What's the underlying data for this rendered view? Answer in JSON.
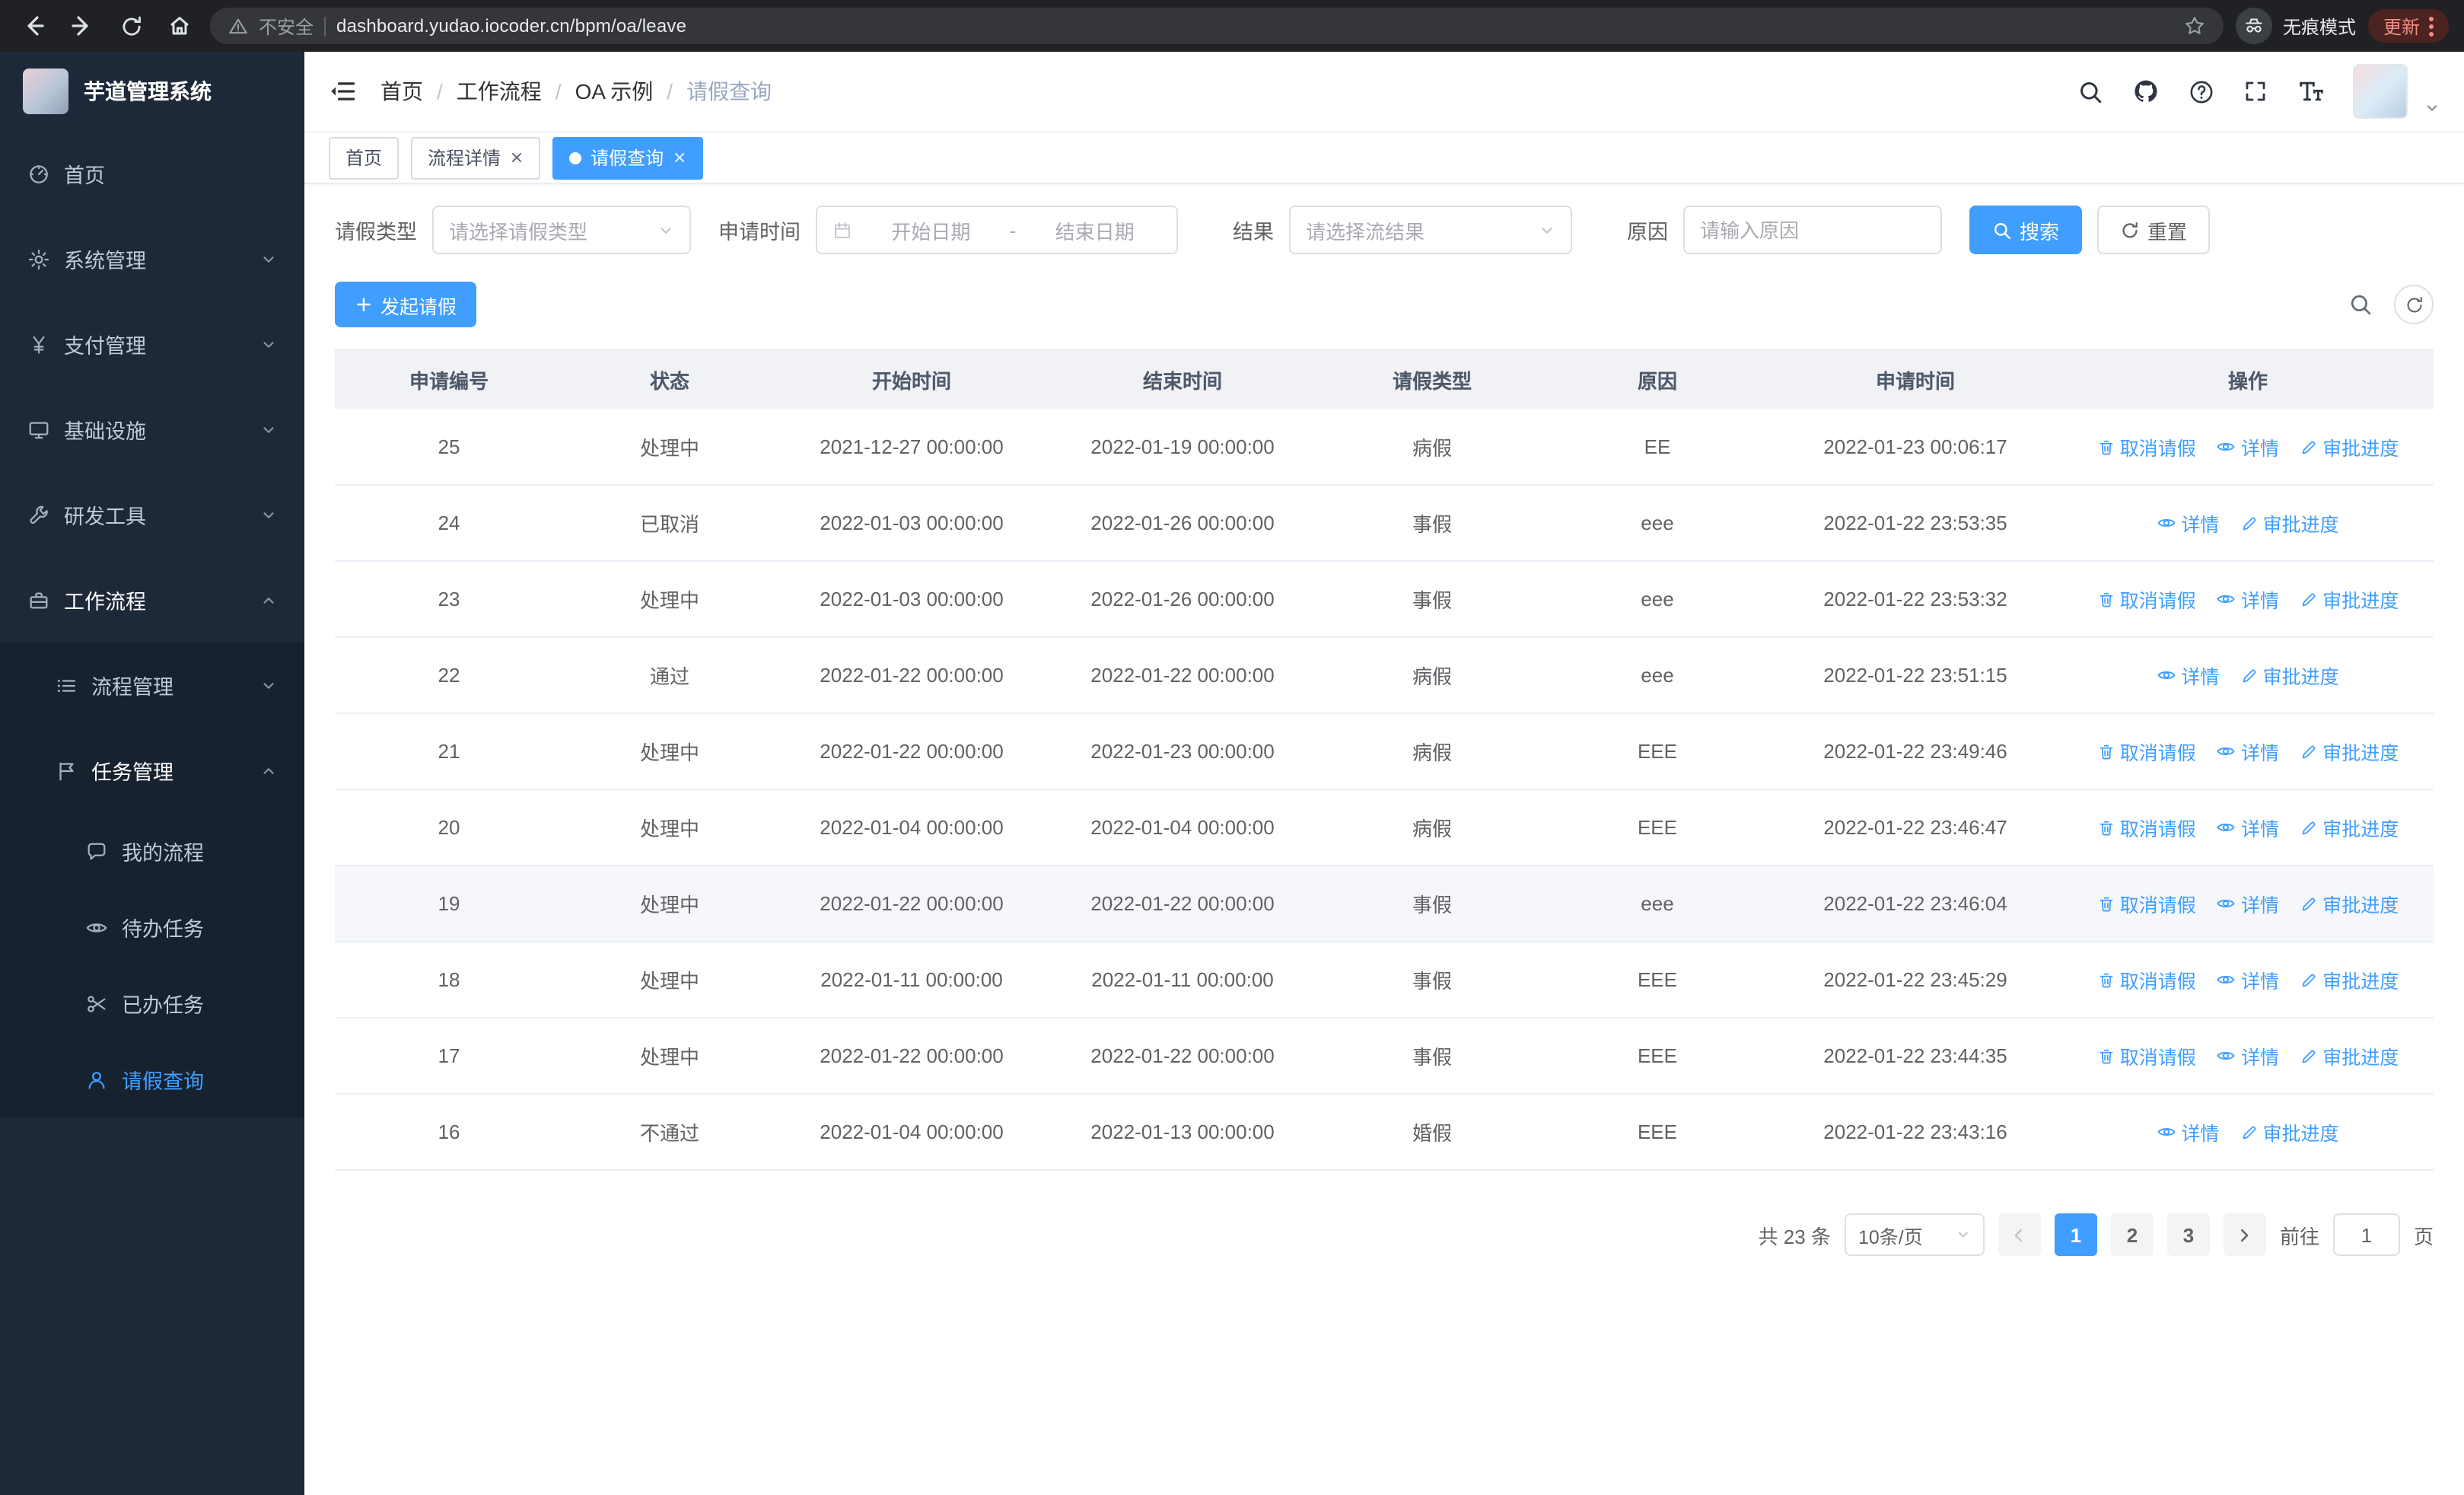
{
  "browser": {
    "security_label": "不安全",
    "url": "dashboard.yudao.iocoder.cn/bpm/oa/leave",
    "incognito_label": "无痕模式",
    "update_label": "更新"
  },
  "sidebar": {
    "logo_title": "芋道管理系统",
    "menu": [
      {
        "label": "首页"
      },
      {
        "label": "系统管理"
      },
      {
        "label": "支付管理"
      },
      {
        "label": "基础设施"
      },
      {
        "label": "研发工具"
      },
      {
        "label": "工作流程",
        "children": [
          {
            "label": "流程管理"
          },
          {
            "label": "任务管理",
            "children": [
              {
                "label": "我的流程"
              },
              {
                "label": "待办任务"
              },
              {
                "label": "已办任务"
              },
              {
                "label": "请假查询"
              }
            ]
          }
        ]
      }
    ]
  },
  "header": {
    "breadcrumb": [
      "首页",
      "工作流程",
      "OA 示例",
      "请假查询"
    ],
    "breadcrumb_separator": "/",
    "icons": [
      "search",
      "github",
      "help",
      "fullscreen",
      "font-size"
    ]
  },
  "tabs": [
    {
      "label": "首页",
      "closable": false,
      "active": false
    },
    {
      "label": "流程详情",
      "closable": true,
      "active": false
    },
    {
      "label": "请假查询",
      "closable": true,
      "active": true
    }
  ],
  "filters": {
    "leave_type_label": "请假类型",
    "leave_type_placeholder": "请选择请假类型",
    "apply_time_label": "申请时间",
    "start_date_placeholder": "开始日期",
    "range_separator": "-",
    "end_date_placeholder": "结束日期",
    "result_label": "结果",
    "result_placeholder": "请选择流结果",
    "reason_label": "原因",
    "reason_placeholder": "请输入原因",
    "search_label": "搜索",
    "reset_label": "重置"
  },
  "toolbar": {
    "create_label": "发起请假"
  },
  "table": {
    "headers": [
      "申请编号",
      "状态",
      "开始时间",
      "结束时间",
      "请假类型",
      "原因",
      "申请时间",
      "操作"
    ],
    "action_labels": {
      "cancel": "取消请假",
      "detail": "详情",
      "progress": "审批进度"
    },
    "rows": [
      {
        "id": "25",
        "status": "处理中",
        "start": "2021-12-27 00:00:00",
        "end": "2022-01-19 00:00:00",
        "type": "病假",
        "reason": "EE",
        "applied": "2022-01-23 00:06:17",
        "cancelable": true,
        "highlighted": false
      },
      {
        "id": "24",
        "status": "已取消",
        "start": "2022-01-03 00:00:00",
        "end": "2022-01-26 00:00:00",
        "type": "事假",
        "reason": "eee",
        "applied": "2022-01-22 23:53:35",
        "cancelable": false,
        "highlighted": false
      },
      {
        "id": "23",
        "status": "处理中",
        "start": "2022-01-03 00:00:00",
        "end": "2022-01-26 00:00:00",
        "type": "事假",
        "reason": "eee",
        "applied": "2022-01-22 23:53:32",
        "cancelable": true,
        "highlighted": false
      },
      {
        "id": "22",
        "status": "通过",
        "start": "2022-01-22 00:00:00",
        "end": "2022-01-22 00:00:00",
        "type": "病假",
        "reason": "eee",
        "applied": "2022-01-22 23:51:15",
        "cancelable": false,
        "highlighted": false
      },
      {
        "id": "21",
        "status": "处理中",
        "start": "2022-01-22 00:00:00",
        "end": "2022-01-23 00:00:00",
        "type": "病假",
        "reason": "EEE",
        "applied": "2022-01-22 23:49:46",
        "cancelable": true,
        "highlighted": false
      },
      {
        "id": "20",
        "status": "处理中",
        "start": "2022-01-04 00:00:00",
        "end": "2022-01-04 00:00:00",
        "type": "病假",
        "reason": "EEE",
        "applied": "2022-01-22 23:46:47",
        "cancelable": true,
        "highlighted": false
      },
      {
        "id": "19",
        "status": "处理中",
        "start": "2022-01-22 00:00:00",
        "end": "2022-01-22 00:00:00",
        "type": "事假",
        "reason": "eee",
        "applied": "2022-01-22 23:46:04",
        "cancelable": true,
        "highlighted": true
      },
      {
        "id": "18",
        "status": "处理中",
        "start": "2022-01-11 00:00:00",
        "end": "2022-01-11 00:00:00",
        "type": "事假",
        "reason": "EEE",
        "applied": "2022-01-22 23:45:29",
        "cancelable": true,
        "highlighted": false
      },
      {
        "id": "17",
        "status": "处理中",
        "start": "2022-01-22 00:00:00",
        "end": "2022-01-22 00:00:00",
        "type": "事假",
        "reason": "EEE",
        "applied": "2022-01-22 23:44:35",
        "cancelable": true,
        "highlighted": false
      },
      {
        "id": "16",
        "status": "不通过",
        "start": "2022-01-04 00:00:00",
        "end": "2022-01-13 00:00:00",
        "type": "婚假",
        "reason": "EEE",
        "applied": "2022-01-22 23:43:16",
        "cancelable": false,
        "highlighted": false
      }
    ]
  },
  "pagination": {
    "total": "共 23 条",
    "page_size": "10条/页",
    "pages": [
      "1",
      "2",
      "3"
    ],
    "active_page": "1",
    "goto_label": "前往",
    "goto_value": "1",
    "page_unit": "页"
  },
  "colors": {
    "accent": "#409eff",
    "sidebar_bg": "#1d2939",
    "active_tab_bg": "#409eff",
    "table_header_bg": "#f0f2f6"
  }
}
